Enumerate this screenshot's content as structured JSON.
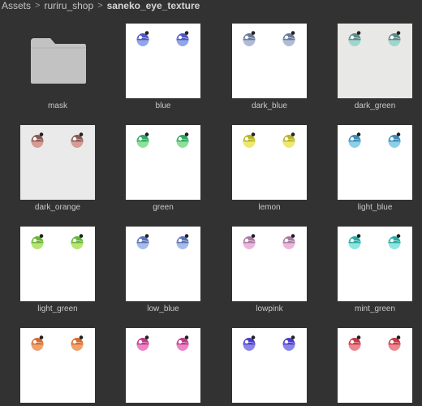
{
  "breadcrumb": {
    "items": [
      "Assets",
      "ruriru_shop",
      "saneko_eye_texture"
    ],
    "separator": ">"
  },
  "assets": [
    {
      "label": "mask",
      "kind": "folder",
      "icon": "folder-icon",
      "folder_color": "#c2c2c2"
    },
    {
      "label": "blue",
      "kind": "texture",
      "bg": "#ffffff",
      "top": "#4e56c8",
      "bottom": "#8fa6e8"
    },
    {
      "label": "dark_blue",
      "kind": "texture",
      "bg": "#ffffff",
      "top": "#6a7898",
      "bottom": "#aebcd8"
    },
    {
      "label": "dark_green",
      "kind": "texture",
      "bg": "#e8e8e6",
      "top": "#5c8a86",
      "bottom": "#9ed6cf"
    },
    {
      "label": "dark_orange",
      "kind": "texture",
      "bg": "#eaeaea",
      "top": "#8a5a54",
      "bottom": "#d89a94"
    },
    {
      "label": "green",
      "kind": "texture",
      "bg": "#ffffff",
      "top": "#2fa860",
      "bottom": "#8fe09a"
    },
    {
      "label": "lemon",
      "kind": "texture",
      "bg": "#ffffff",
      "top": "#b8b428",
      "bottom": "#ece870"
    },
    {
      "label": "light_blue",
      "kind": "texture",
      "bg": "#ffffff",
      "top": "#3e8ab8",
      "bottom": "#8ccfe8"
    },
    {
      "label": "light_green",
      "kind": "texture",
      "bg": "#ffffff",
      "top": "#68b434",
      "bottom": "#b6e476"
    },
    {
      "label": "low_blue",
      "kind": "texture",
      "bg": "#ffffff",
      "top": "#5a72b4",
      "bottom": "#a6bce8"
    },
    {
      "label": "lowpink",
      "kind": "texture",
      "bg": "#ffffff",
      "top": "#a87aa2",
      "bottom": "#eab6dc"
    },
    {
      "label": "mint_green",
      "kind": "texture",
      "bg": "#ffffff",
      "top": "#2aa8a4",
      "bottom": "#8ee6e0"
    },
    {
      "label": "",
      "kind": "texture",
      "bg": "#ffffff",
      "top": "#d86a2e",
      "bottom": "#eea26c"
    },
    {
      "label": "",
      "kind": "texture",
      "bg": "#ffffff",
      "top": "#c03a88",
      "bottom": "#ea86c6"
    },
    {
      "label": "",
      "kind": "texture",
      "bg": "#ffffff",
      "top": "#4a3cc8",
      "bottom": "#8a86ea"
    },
    {
      "label": "",
      "kind": "texture",
      "bg": "#ffffff",
      "top": "#c83848",
      "bottom": "#ea8890"
    }
  ]
}
